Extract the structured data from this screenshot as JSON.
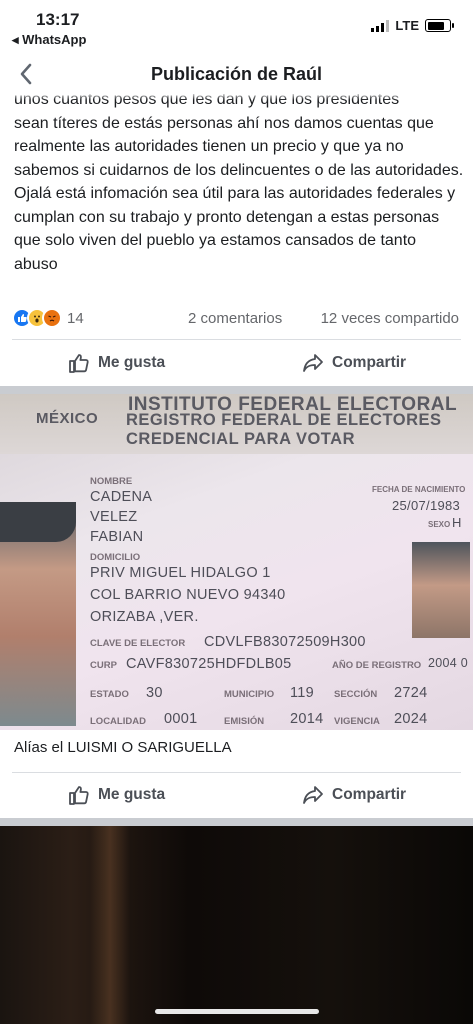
{
  "status": {
    "time": "13:17",
    "back_app": "◂ WhatsApp",
    "network": "LTE"
  },
  "nav": {
    "title": "Publicación de Raúl",
    "back_icon": "chevron-left-icon"
  },
  "post": {
    "lines_partial": "unos cuantos pesos que les dan y que los presidentes",
    "paragraph1": "sean títeres de estás personas ahí nos damos cuentas que realmente las autoridades tienen un precio y que ya no sabemos si cuidarnos de los delincuentes o de las autoridades.",
    "paragraph2": "Ojalá está infomación sea útil para las autoridades federales y cumplan con su trabajo y pronto detengan a estas personas que solo viven del pueblo ya estamos cansados de tanto abuso"
  },
  "stats": {
    "reaction_count": "14",
    "comments": "2 comentarios",
    "shares": "12 veces compartido"
  },
  "actions": {
    "like": "Me gusta",
    "share": "Compartir"
  },
  "idcard": {
    "inst_line1": "INSTITUTO FEDERAL ELECTORAL",
    "country": "MÉXICO",
    "inst_line2": "REGISTRO FEDERAL DE ELECTORES",
    "inst_line3": "CREDENCIAL PARA VOTAR",
    "nombre_label": "NOMBRE",
    "name1": "CADENA",
    "name2": "VELEZ",
    "name3": "FABIAN",
    "domicilio_label": "DOMICILIO",
    "addr1": "PRIV MIGUEL HIDALGO 1",
    "addr2": "COL BARRIO NUEVO 94340",
    "addr3": "ORIZABA ,VER.",
    "clave_label": "CLAVE DE ELECTOR",
    "clave": "CDVLFB83072509H300",
    "curp_label": "CURP",
    "curp": "CAVF830725HDFDLB05",
    "registro_label": "AÑO DE REGISTRO",
    "registro": "2004 0",
    "estado_label": "ESTADO",
    "estado": "30",
    "municipio_label": "MUNICIPIO",
    "municipio": "119",
    "seccion_label": "SECCIÓN",
    "seccion": "2724",
    "localidad_label": "LOCALIDAD",
    "localidad": "0001",
    "emision_label": "EMISIÓN",
    "emision": "2014",
    "vigencia_label": "VIGENCIA",
    "vigencia": "2024",
    "fecha_label": "FECHA DE NACIMIENTO",
    "fecha": "25/07/1983",
    "sexo_label": "SEXO",
    "sexo": "H"
  },
  "caption": "Alías el LUISMI O SARIGUELLA"
}
